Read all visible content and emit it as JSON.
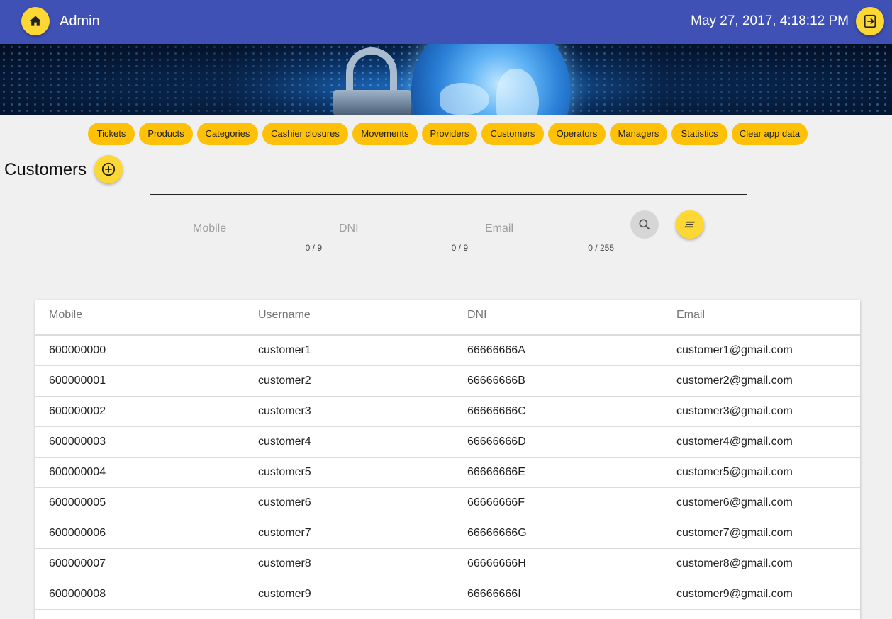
{
  "header": {
    "title": "Admin",
    "datetime": "May 27, 2017, 4:18:12 PM",
    "home_icon": "home-icon",
    "logout_icon": "logout-icon",
    "bar_color": "#3f51b5",
    "accent_color": "#fdd835"
  },
  "nav": {
    "items": [
      {
        "label": "Tickets"
      },
      {
        "label": "Products"
      },
      {
        "label": "Categories"
      },
      {
        "label": "Cashier closures"
      },
      {
        "label": "Movements"
      },
      {
        "label": "Providers"
      },
      {
        "label": "Customers"
      },
      {
        "label": "Operators"
      },
      {
        "label": "Managers"
      },
      {
        "label": "Statistics"
      },
      {
        "label": "Clear app data"
      }
    ],
    "chip_color": "#ffc107"
  },
  "page": {
    "title": "Customers",
    "add_icon": "add-circle-icon"
  },
  "filters": {
    "mobile": {
      "placeholder": "Mobile",
      "value": "",
      "counter": "0 / 9"
    },
    "dni": {
      "placeholder": "DNI",
      "value": "",
      "counter": "0 / 9"
    },
    "email": {
      "placeholder": "Email",
      "value": "",
      "counter": "0 / 255"
    },
    "search_icon": "search-icon",
    "clear_icon": "clear-filters-icon"
  },
  "table": {
    "columns": [
      "Mobile",
      "Username",
      "DNI",
      "Email"
    ],
    "rows": [
      {
        "mobile": "600000000",
        "username": "customer1",
        "dni": "66666666A",
        "email": "customer1@gmail.com"
      },
      {
        "mobile": "600000001",
        "username": "customer2",
        "dni": "66666666B",
        "email": "customer2@gmail.com"
      },
      {
        "mobile": "600000002",
        "username": "customer3",
        "dni": "66666666C",
        "email": "customer3@gmail.com"
      },
      {
        "mobile": "600000003",
        "username": "customer4",
        "dni": "66666666D",
        "email": "customer4@gmail.com"
      },
      {
        "mobile": "600000004",
        "username": "customer5",
        "dni": "66666666E",
        "email": "customer5@gmail.com"
      },
      {
        "mobile": "600000005",
        "username": "customer6",
        "dni": "66666666F",
        "email": "customer6@gmail.com"
      },
      {
        "mobile": "600000006",
        "username": "customer7",
        "dni": "66666666G",
        "email": "customer7@gmail.com"
      },
      {
        "mobile": "600000007",
        "username": "customer8",
        "dni": "66666666H",
        "email": "customer8@gmail.com"
      },
      {
        "mobile": "600000008",
        "username": "customer9",
        "dni": "66666666I",
        "email": "customer9@gmail.com"
      }
    ]
  }
}
